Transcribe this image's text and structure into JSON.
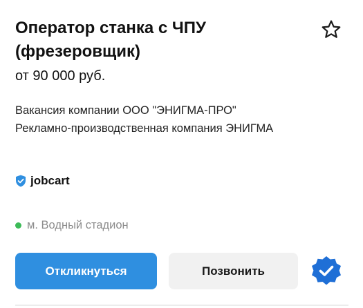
{
  "vacancy": {
    "title_line1": "Оператор станка с ЧПУ",
    "title_line2": "(фрезеровщик)",
    "salary": "от 90 000 руб.",
    "company_line1": "Вакансия компании ООО \"ЭНИГМА-ПРО\"",
    "company_line2": "Рекламно-производственная компания ЭНИГМА"
  },
  "source": {
    "name": "jobcart",
    "icon": "shield-check-icon"
  },
  "location": {
    "metro": "м. Водный стадион",
    "metro_color": "#3dbb58"
  },
  "actions": {
    "apply_label": "Откликнуться",
    "call_label": "Позвонить"
  },
  "icons": {
    "favorite": "star-outline-icon",
    "verified": "verified-badge-icon"
  },
  "colors": {
    "accent": "#2f8fe0",
    "secondary_button": "#f1f1f1",
    "verified": "#1f6fd6"
  }
}
